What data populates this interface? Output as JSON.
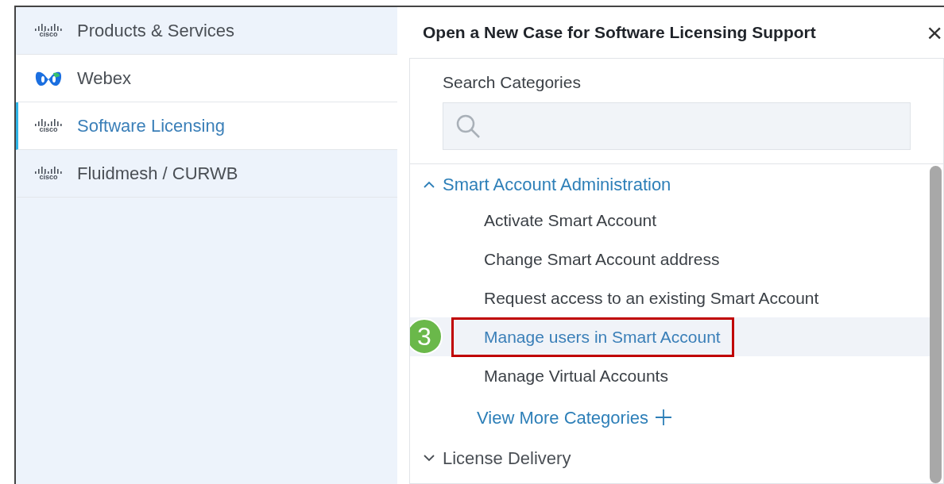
{
  "sidebar": {
    "items": [
      {
        "label": "Products & Services",
        "logo": {
          "kind": "cisco",
          "text": "cisco"
        },
        "selected": false,
        "white": false
      },
      {
        "label": "Webex",
        "logo": {
          "kind": "webex"
        },
        "selected": false,
        "white": true
      },
      {
        "label": "Software Licensing",
        "logo": {
          "kind": "cisco",
          "text": "cisco"
        },
        "selected": true,
        "white": true
      },
      {
        "label": "Fluidmesh / CURWB",
        "logo": {
          "kind": "cisco",
          "text": "cisco"
        },
        "selected": false,
        "white": false
      }
    ]
  },
  "dialog": {
    "title": "Open a New Case for Software Licensing Support",
    "close": "×",
    "search": {
      "label": "Search Categories"
    },
    "categories": [
      {
        "label": "Smart Account Administration",
        "expanded": true,
        "children": [
          {
            "label": "Activate Smart Account",
            "selected": false
          },
          {
            "label": "Change Smart Account address",
            "selected": false
          },
          {
            "label": "Request access to an existing Smart Account",
            "selected": false
          },
          {
            "label": "Manage users in Smart Account",
            "selected": true,
            "callout": "3"
          },
          {
            "label": "Manage Virtual Accounts",
            "selected": false
          }
        ],
        "more": "View More Categories"
      },
      {
        "label": "License Delivery",
        "expanded": false
      }
    ]
  }
}
